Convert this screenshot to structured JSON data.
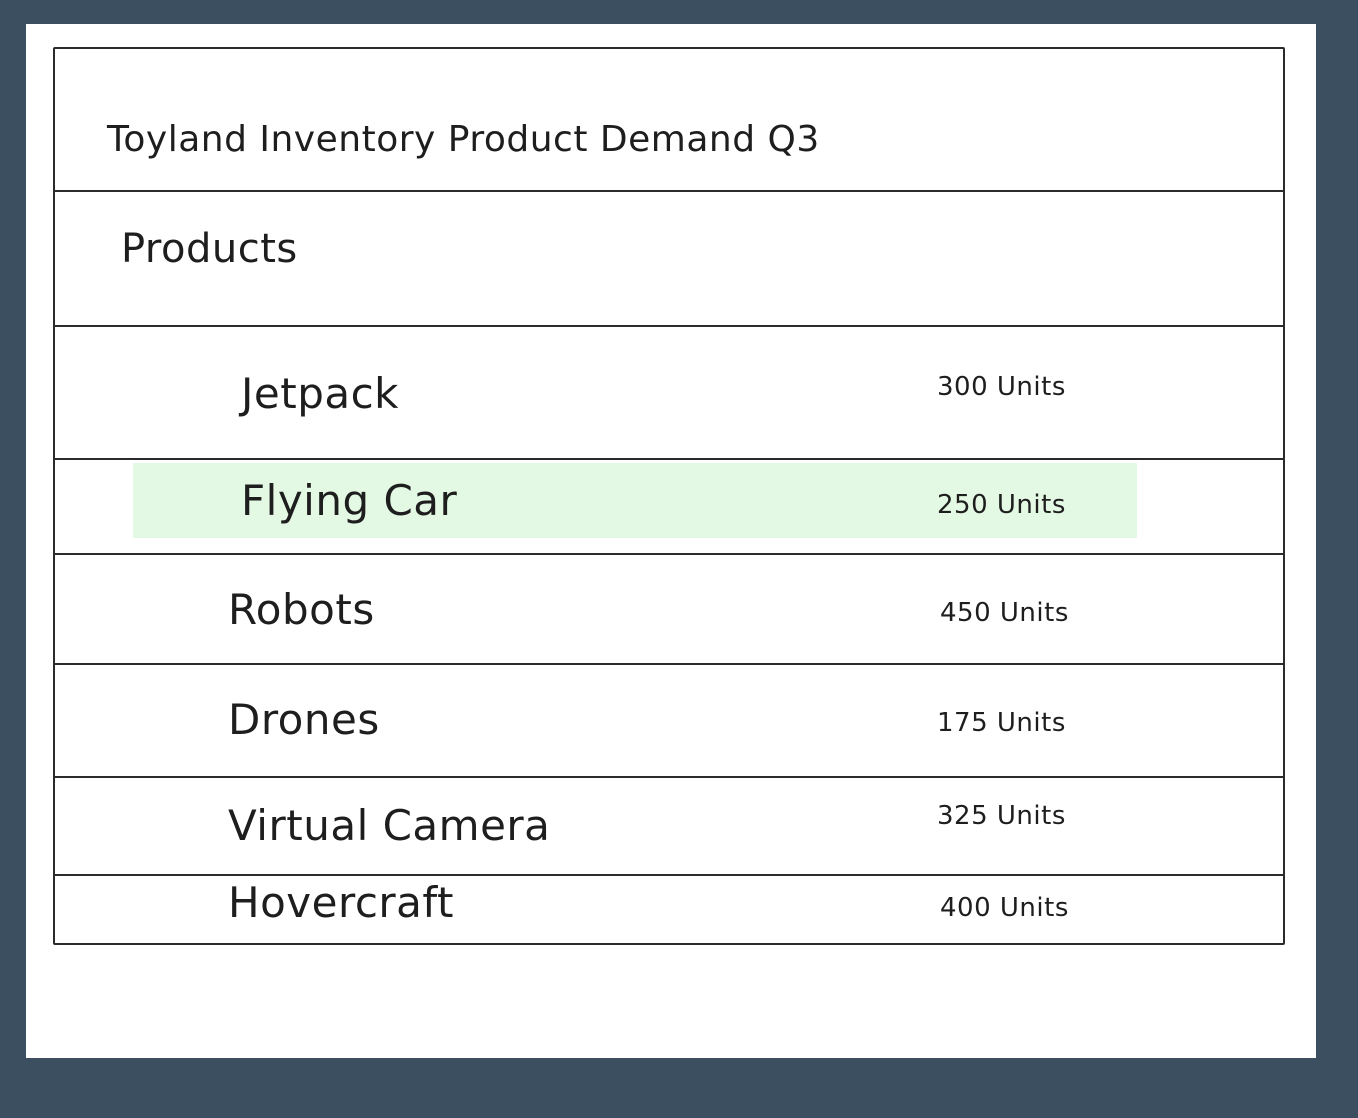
{
  "window": {
    "title": "Toyland Inventory Product Demand Q3"
  },
  "section": {
    "label": "Products"
  },
  "products": [
    {
      "name": "Jetpack",
      "units": "300 Units",
      "highlighted": false
    },
    {
      "name": "Flying Car",
      "units": "250 Units",
      "highlighted": true
    },
    {
      "name": "Robots",
      "units": "450 Units",
      "highlighted": false
    },
    {
      "name": "Drones",
      "units": "175 Units",
      "highlighted": false
    },
    {
      "name": "Virtual Camera",
      "units": "325 Units",
      "highlighted": false
    },
    {
      "name": "Hovercraft",
      "units": "400 Units",
      "highlighted": false
    }
  ],
  "colors": {
    "background": "#3b4f61",
    "highlight": "#e4f9e4",
    "border": "#2b2b2b"
  }
}
